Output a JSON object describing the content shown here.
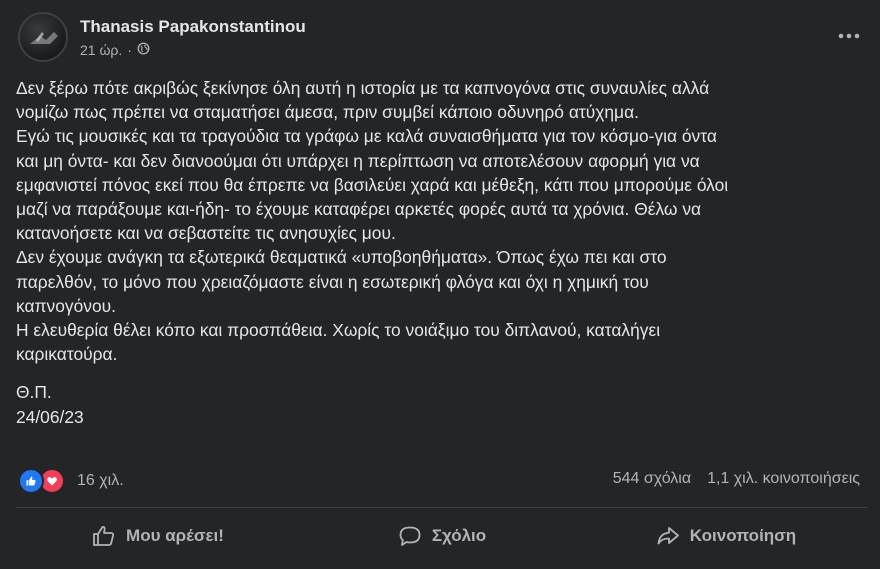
{
  "post": {
    "author": "Thanasis Papakonstantinou",
    "time": "21 ώρ.",
    "separator": "·",
    "audience_icon": "globe-icon",
    "more_icon": "more-options-icon",
    "paragraphs": [
      "Δεν ξέρω πότε ακριβώς ξεκίνησε όλη αυτή η ιστορία με τα καπνογόνα στις συναυλίες αλλά\nνομίζω πως πρέπει να σταματήσει άμεσα, πριν συμβεί κάποιο οδυνηρό ατύχημα.",
      "Εγώ τις μουσικές και τα τραγούδια τα γράφω με καλά συναισθήματα για τον κόσμο-για όντα\nκαι μη όντα- και δεν διανοούμαι ότι  υπάρχει η περίπτωση  να αποτελέσουν αφορμή για να\nεμφανιστεί πόνος εκεί που θα έπρεπε να βασιλεύει χαρά και μέθεξη, κάτι που μπορούμε όλοι\nμαζί να παράξουμε και-ήδη- το έχουμε καταφέρει αρκετές φορές αυτά τα χρόνια. Θέλω να\nκατανοήσετε και να σεβαστείτε τις ανησυχίες μου.",
      "Δεν έχουμε ανάγκη τα εξωτερικά θεαματικά «υποβοηθήματα». Όπως έχω πει και στο\nπαρελθόν, το μόνο που χρειαζόμαστε είναι η εσωτερική φλόγα και όχι η χημική του\nκαπνογόνου.",
      "Η ελευθερία θέλει κόπο και προσπάθεια. Χωρίς το νοιάξιμο του διπλανού, καταλήγει\nκαρικατούρα."
    ],
    "signature": "Θ.Π.",
    "date": "24/06/23"
  },
  "stats": {
    "reaction_icons": [
      "like-icon",
      "love-icon"
    ],
    "reactions": "16 χιλ.",
    "comments": "544 σχόλια",
    "shares": "1,1 χιλ. κοινοποιήσεις"
  },
  "actions": {
    "like": "Μου αρέσει!",
    "comment": "Σχόλιο",
    "share": "Κοινοποίηση"
  },
  "colors": {
    "background": "#242526",
    "text": "#e4e6eb",
    "secondary_text": "#b0b3b8",
    "like_blue": "#2078f4",
    "love_red": "#f33e58"
  }
}
